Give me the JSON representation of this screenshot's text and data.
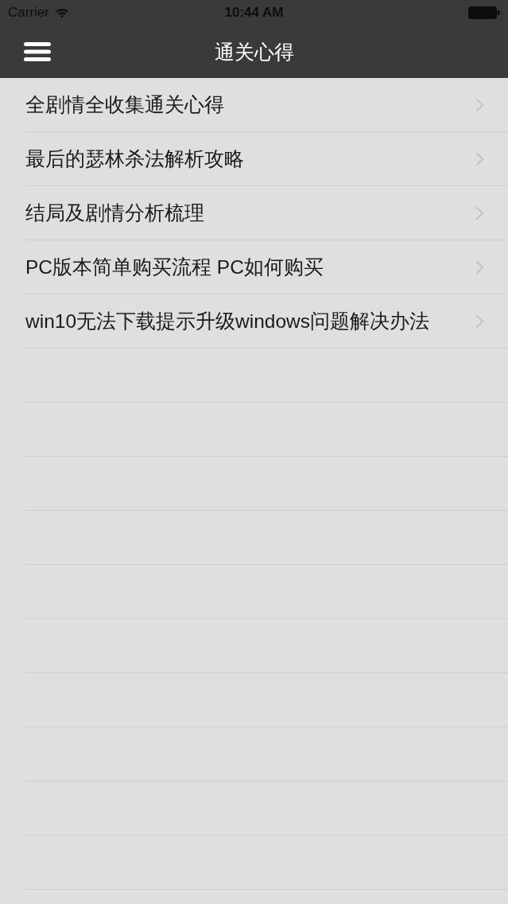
{
  "status_bar": {
    "carrier": "Carrier",
    "time": "10:44 AM"
  },
  "nav_bar": {
    "title": "通关心得"
  },
  "list": {
    "items": [
      {
        "label": "全剧情全收集通关心得"
      },
      {
        "label": "最后的瑟林杀法解析攻略"
      },
      {
        "label": "结局及剧情分析梳理"
      },
      {
        "label": "PC版本简单购买流程 PC如何购买"
      },
      {
        "label": "win10无法下载提示升级windows问题解决办法"
      }
    ]
  }
}
